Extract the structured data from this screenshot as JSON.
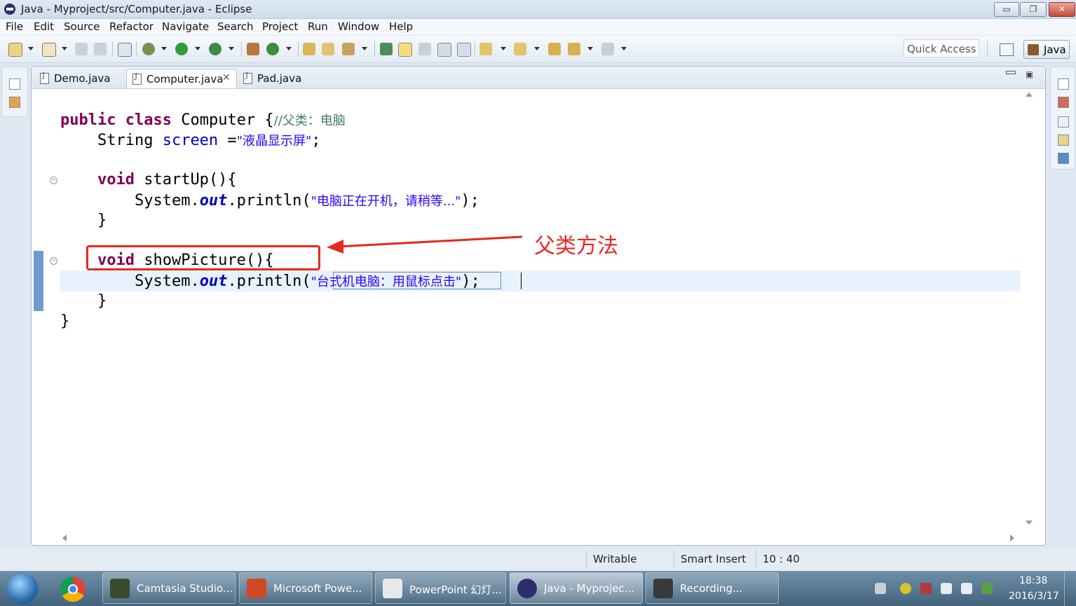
{
  "window": {
    "title": "Java - Myproject/src/Computer.java - Eclipse",
    "min_symbol": "▭",
    "max_symbol": "❐",
    "close_symbol": "✕"
  },
  "menu": [
    "File",
    "Edit",
    "Source",
    "Refactor",
    "Navigate",
    "Search",
    "Project",
    "Run",
    "Window",
    "Help"
  ],
  "toolbar": {
    "quick_access_placeholder": "Quick Access",
    "perspective_label": "Java"
  },
  "tabs": [
    {
      "label": "Demo.java",
      "active": false
    },
    {
      "label": "Computer.java",
      "active": true,
      "close_symbol": "✕"
    },
    {
      "label": "Pad.java",
      "active": false
    }
  ],
  "code": {
    "line1": {
      "kw1": "public",
      "kw2": "class",
      "name": "Computer {",
      "comment": "//父类：电脑"
    },
    "line2": {
      "type": "String ",
      "field": "screen",
      "eq": " =",
      "string": "\"液晶显示屏\"",
      "end": ";"
    },
    "line3": {
      "kw": "void",
      "rest": " startUp(){"
    },
    "line4": {
      "obj": "System.",
      "field": "out",
      "call": ".println(",
      "string": "\"电脑正在开机，请稍等...\"",
      "end": ");"
    },
    "line5": {
      "text": "}"
    },
    "line6": {
      "kw": "void",
      "rest": " showPicture(){"
    },
    "line7": {
      "obj": "System.",
      "field": "out",
      "call": ".println(",
      "string": "\"台式机电脑：用鼠标点击\"",
      "end": ");"
    },
    "line8": {
      "text": "}"
    },
    "line9": {
      "text": "}"
    }
  },
  "annotation": {
    "label": "父类方法",
    "color": "#e8271e"
  },
  "status": {
    "writable": "Writable",
    "insert_mode": "Smart Insert",
    "cursor_position": "10 : 40"
  },
  "taskbar": {
    "items": [
      {
        "label": "Camtasia Studio...",
        "icon_color": "#3a4a2a"
      },
      {
        "label": "Microsoft Powe...",
        "icon_color": "#d24726"
      },
      {
        "label": "PowerPoint 幻灯...",
        "icon_color": "#e8e8e8"
      },
      {
        "label": "Java - Myprojec...",
        "icon_color": "#2c2f6b"
      },
      {
        "label": "Recording...",
        "icon_color": "#3a3a3a"
      }
    ],
    "time": "18:38",
    "date": "2016/3/17"
  }
}
